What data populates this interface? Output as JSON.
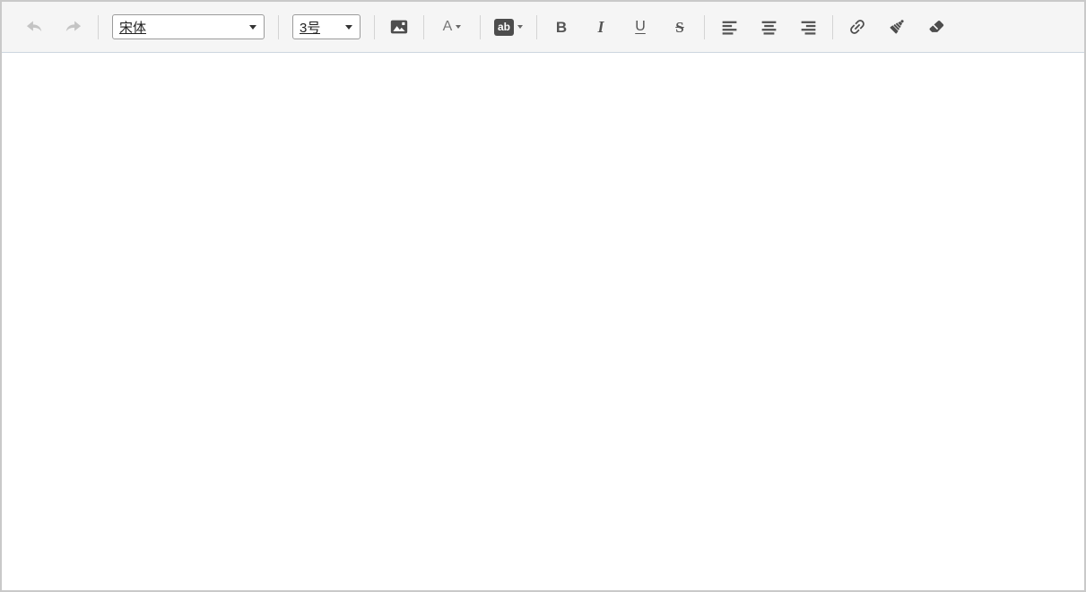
{
  "toolbar": {
    "font_family": {
      "value": "宋体"
    },
    "font_size": {
      "value": "3号"
    },
    "font_color_label": "A",
    "highlight_label": "ab",
    "bold_label": "B",
    "italic_label": "I",
    "underline_label": "U",
    "strikethrough_label": "S"
  },
  "content": {
    "text": ""
  },
  "colors": {
    "toolbar_bg": "#f5f5f5",
    "toolbar_border_bottom": "#cdd6df",
    "outer_border": "#c9c9c9",
    "icon": "#4d4d4d",
    "icon_disabled": "#c4c4c4",
    "letter": "#555555",
    "select_border": "#9b9b9b",
    "separator": "#d4d4d4",
    "content_bg": "#ffffff",
    "select_text": "#222222"
  }
}
